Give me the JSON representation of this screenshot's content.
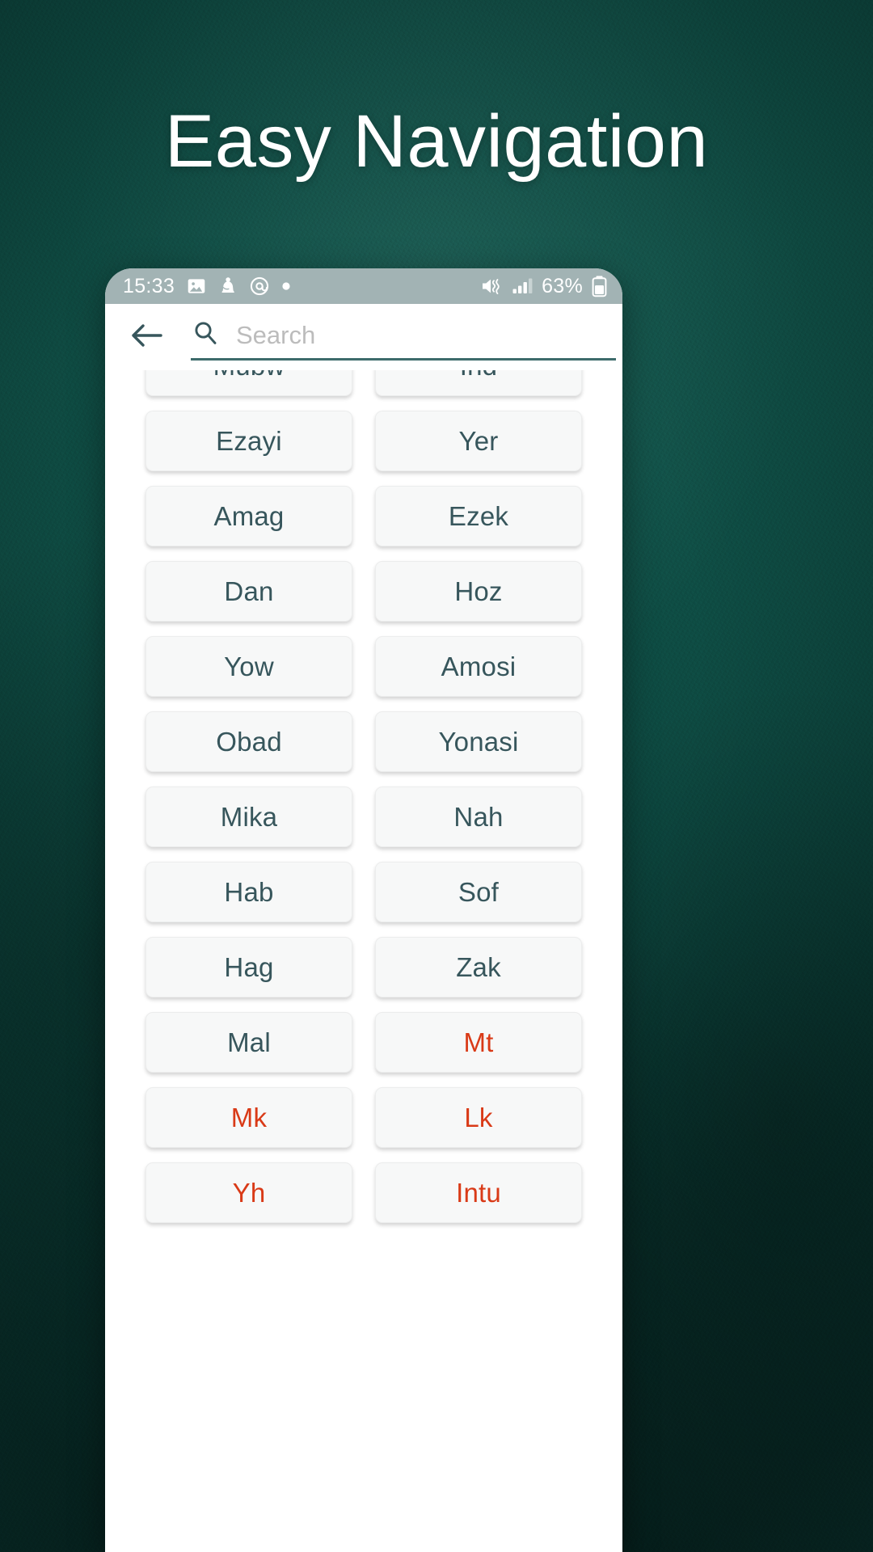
{
  "headline": "Easy Navigation",
  "colors": {
    "background": "#0d4a42",
    "headline_text": "#ffffff",
    "statusbar_bg": "#a2b3b4",
    "card_bg": "#f7f8f8",
    "card_text": "#37565c",
    "card_text_highlight": "#d93a17",
    "search_underline": "#3d6b6b"
  },
  "phone": {
    "statusbar": {
      "time": "15:33",
      "left_icons": [
        "image-icon",
        "notification-icon",
        "email-at-icon",
        "dot-icon"
      ],
      "right_icons": [
        "mute-vibrate-icon",
        "signal-bars-icon",
        "battery-icon"
      ],
      "battery_percent": "63%"
    },
    "toolbar": {
      "back_icon": "arrow-left-icon",
      "search_icon": "search-icon",
      "search_value": "",
      "search_placeholder": "Search"
    },
    "grid": {
      "columns": 2,
      "items": [
        {
          "label": "Mubw",
          "highlight": false
        },
        {
          "label": "Ind",
          "highlight": false
        },
        {
          "label": "Ezayi",
          "highlight": false
        },
        {
          "label": "Yer",
          "highlight": false
        },
        {
          "label": "Amag",
          "highlight": false
        },
        {
          "label": "Ezek",
          "highlight": false
        },
        {
          "label": "Dan",
          "highlight": false
        },
        {
          "label": "Hoz",
          "highlight": false
        },
        {
          "label": "Yow",
          "highlight": false
        },
        {
          "label": "Amosi",
          "highlight": false
        },
        {
          "label": "Obad",
          "highlight": false
        },
        {
          "label": "Yonasi",
          "highlight": false
        },
        {
          "label": "Mika",
          "highlight": false
        },
        {
          "label": "Nah",
          "highlight": false
        },
        {
          "label": "Hab",
          "highlight": false
        },
        {
          "label": "Sof",
          "highlight": false
        },
        {
          "label": "Hag",
          "highlight": false
        },
        {
          "label": "Zak",
          "highlight": false
        },
        {
          "label": "Mal",
          "highlight": false
        },
        {
          "label": "Mt",
          "highlight": true
        },
        {
          "label": "Mk",
          "highlight": true
        },
        {
          "label": "Lk",
          "highlight": true
        },
        {
          "label": "Yh",
          "highlight": true
        },
        {
          "label": "Intu",
          "highlight": true
        }
      ]
    }
  }
}
